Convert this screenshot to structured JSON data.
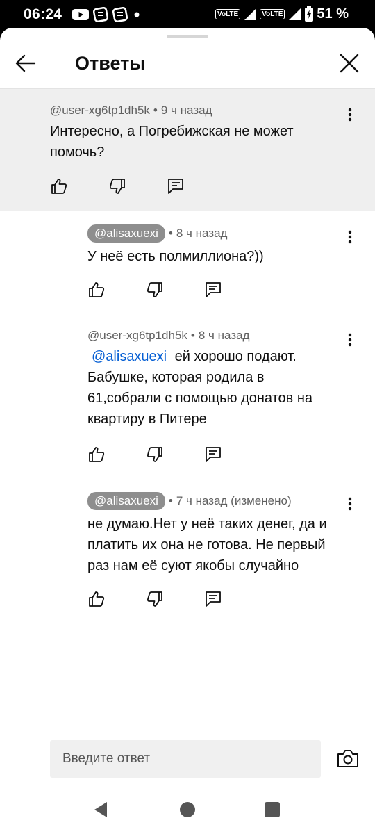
{
  "status_bar": {
    "time": "06:24",
    "volte1": "VoLTE",
    "volte2": "VoLTE",
    "battery_pct": "51 %",
    "icons": [
      "youtube-icon",
      "app-icon",
      "app-icon",
      "dot-icon",
      "signal-icon",
      "battery-icon"
    ]
  },
  "header": {
    "title": "Ответы"
  },
  "comments": [
    {
      "author": "@user-xg6tp1dh5k",
      "time": "9 ч назад",
      "text": "Интересно, а Погребижская не может помочь?"
    },
    {
      "author": "@alisaxuexi",
      "time": "8 ч назад",
      "text": "У неё есть полмиллиона?))"
    },
    {
      "author": "@user-xg6tp1dh5k",
      "time": "8 ч назад",
      "mention": "@alisaxuexi",
      "text": " ей хорошо подают. Бабушке, которая родила в 61,собрали с помощью донатов на квартиру в Питере"
    },
    {
      "author": "@alisaxuexi",
      "time": "7 ч назад (изменено)",
      "text": "не думаю.Нет у неё таких денег, да и платить их она не готова. Не первый раз нам её суют якобы случайно"
    }
  ],
  "separator": "•",
  "reply": {
    "placeholder": "Введите ответ"
  }
}
